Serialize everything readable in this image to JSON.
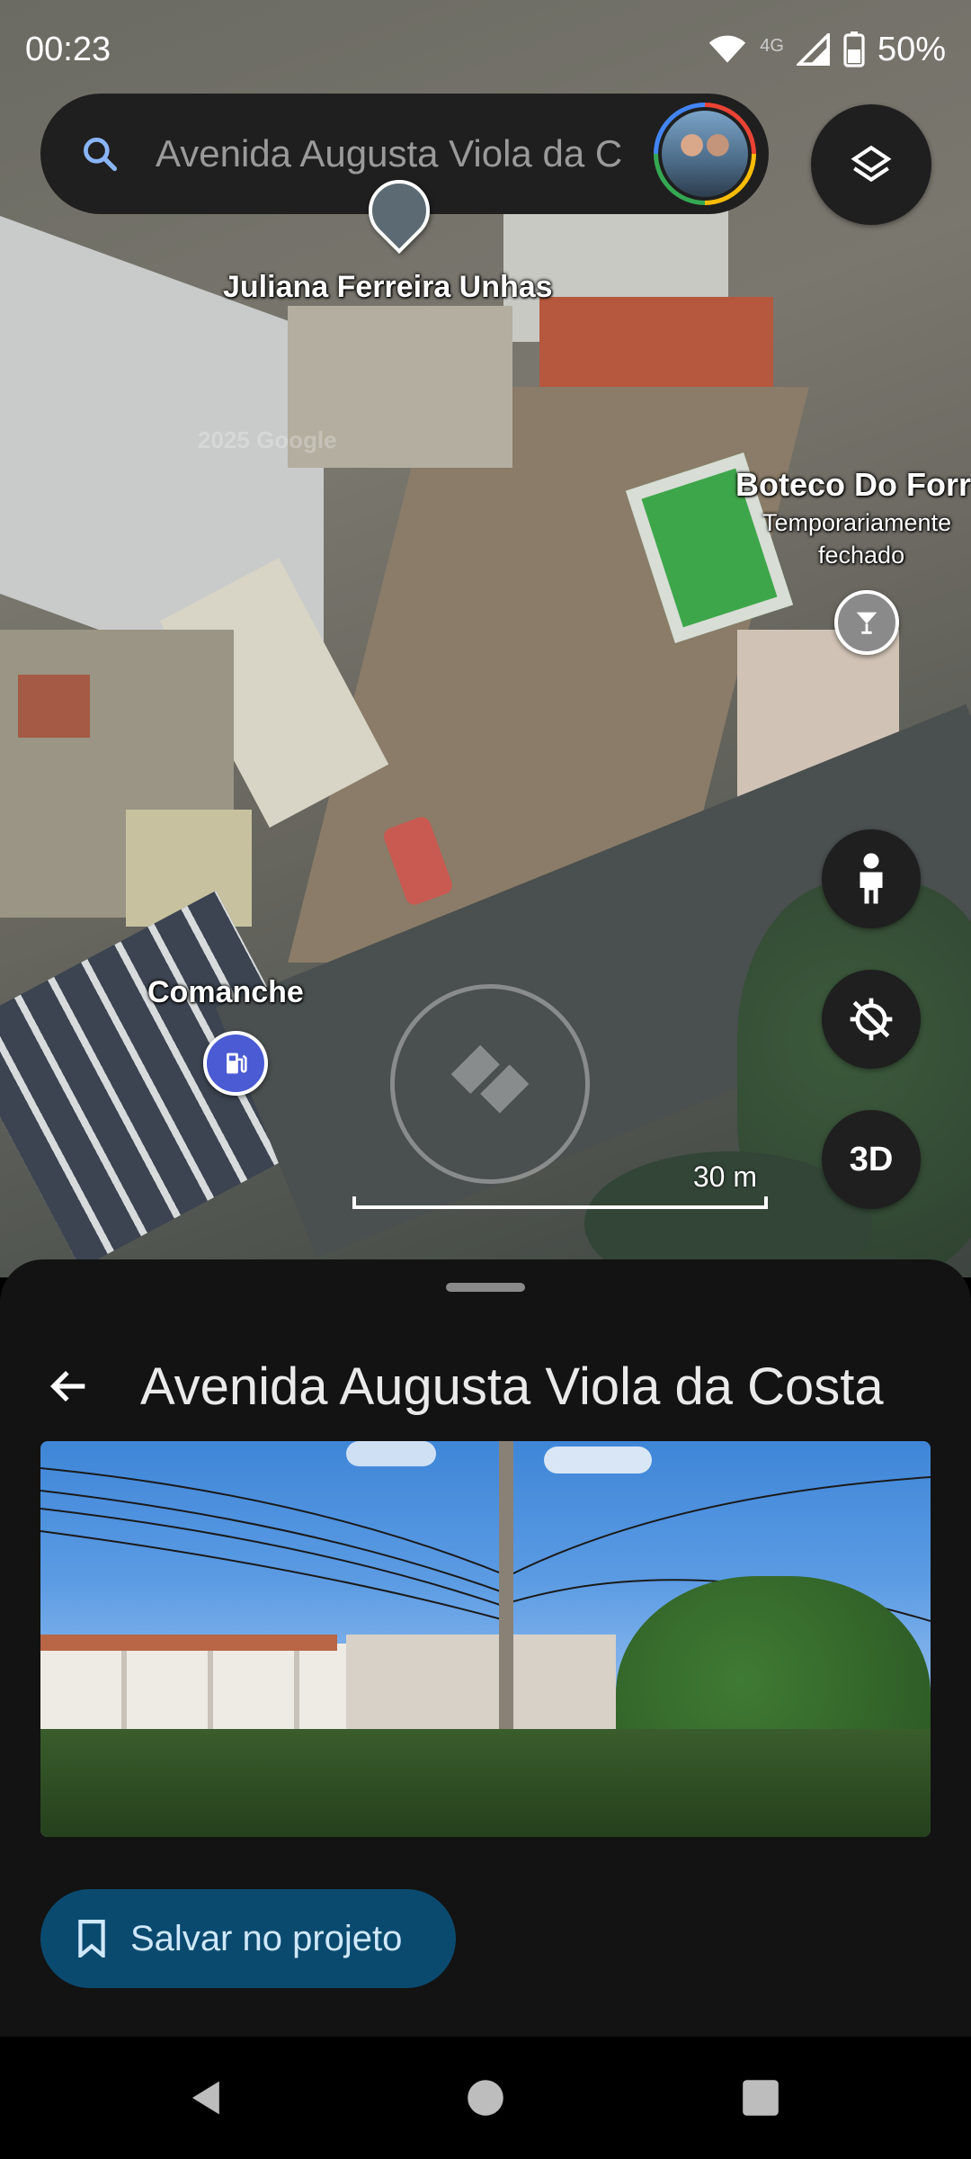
{
  "status_bar": {
    "time": "00:23",
    "network": "4G",
    "battery": "50%"
  },
  "search": {
    "value": "Avenida Augusta Viola da C"
  },
  "map": {
    "labels": {
      "juliana": "Juliana Ferreira Unhas",
      "boteco_name": "Boteco Do Forr",
      "boteco_status_1": "Temporariamente",
      "boteco_status_2": "fechado",
      "comanche": "Comanche",
      "watermark_text": "2025 Google"
    },
    "scale_label": "30 m",
    "btn_3d_label": "3D"
  },
  "sheet": {
    "title": "Avenida Augusta Viola da Costa",
    "save_label": "Salvar no projeto"
  },
  "colors": {
    "sheet_bg": "#131313",
    "save_button_bg": "#0b4a6f",
    "search_bg": "#1f1f1f",
    "fuel_pin": "#4a5bd4",
    "bar_pin": "#8a8a8a"
  },
  "icons": {
    "search": "search-icon",
    "layers": "layers-icon",
    "pegman": "pegman-icon",
    "location": "location-off-icon",
    "back": "back-arrow-icon",
    "bookmark": "bookmark-icon"
  }
}
